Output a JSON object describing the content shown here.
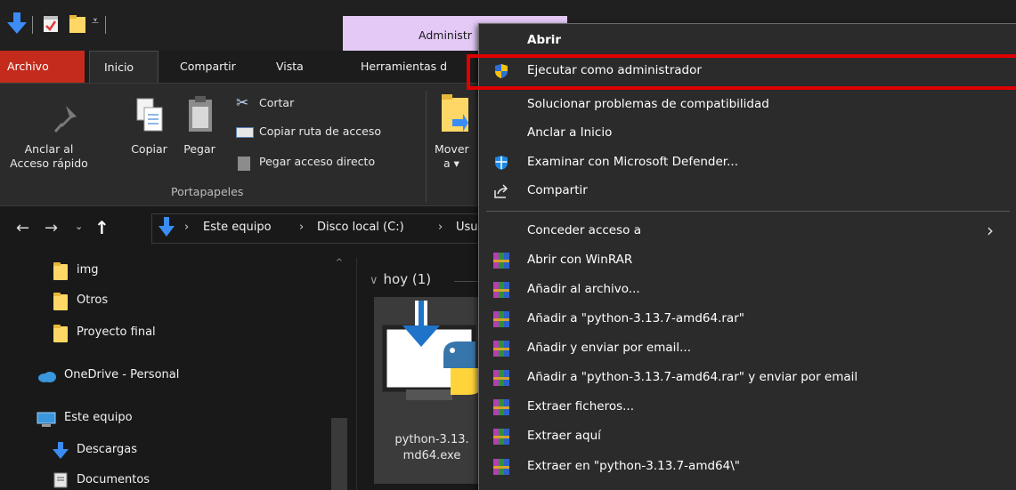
{
  "title_bar": {
    "contextual_tab_label": "Administr"
  },
  "ribbon_tabs": {
    "archivo": "Archivo",
    "inicio": "Inicio",
    "compartir": "Compartir",
    "vista": "Vista",
    "herramientas": "Herramientas d"
  },
  "ribbon": {
    "anclar_line1": "Anclar al",
    "anclar_line2": "Acceso rápido",
    "copiar": "Copiar",
    "pegar": "Pegar",
    "cortar": "Cortar",
    "copiar_ruta": "Copiar ruta de acceso",
    "pegar_acceso": "Pegar acceso directo",
    "portapapeles": "Portapapeles",
    "mover_line1": "Mover",
    "mover_line2": "a ▾"
  },
  "address_bar": {
    "crumbs": [
      "Este equipo",
      "Disco local (C:)",
      "Usu"
    ]
  },
  "nav_pane": {
    "items": [
      "img",
      "Otros",
      "Proyecto final",
      "OneDrive - Personal",
      "Este equipo",
      "Descargas",
      "Documentos"
    ]
  },
  "content": {
    "group_header": "hoy (1)",
    "file_name_line1": "python-3.13.",
    "file_name_line2": "md64.exe"
  },
  "context_menu": {
    "items": [
      "Abrir",
      "Ejecutar como administrador",
      "Solucionar problemas de compatibilidad",
      "Anclar a Inicio",
      "Examinar con Microsoft Defender...",
      "Compartir",
      "Conceder acceso a",
      "Abrir con WinRAR",
      "Añadir al archivo...",
      "Añadir a \"python-3.13.7-amd64.rar\"",
      "Añadir y enviar por email...",
      "Añadir a \"python-3.13.7-amd64.rar\" y enviar por email",
      "Extraer ficheros...",
      "Extraer aquí",
      "Extraer en \"python-3.13.7-amd64\\\""
    ]
  },
  "colors": {
    "highlight_border": "#e00000",
    "archivo_tab": "#c42b1c",
    "contextual_tab": "#e4c9f6",
    "menu_bg": "#2b2b2b"
  }
}
